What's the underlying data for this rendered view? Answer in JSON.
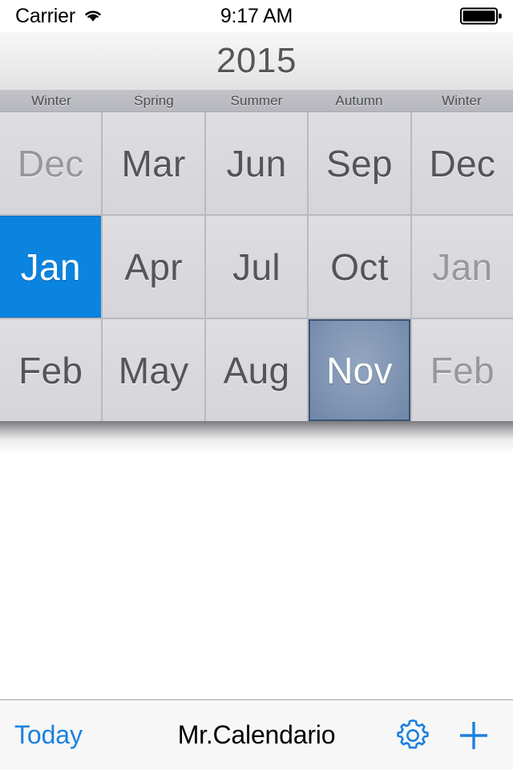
{
  "status_bar": {
    "carrier": "Carrier",
    "wifi_icon": "wifi-icon",
    "time": "9:17 AM",
    "battery_icon": "battery-full-icon"
  },
  "nav_bar": {
    "year": "2015"
  },
  "seasons": [
    {
      "label": "Winter"
    },
    {
      "label": "Spring"
    },
    {
      "label": "Summer"
    },
    {
      "label": "Autumn"
    },
    {
      "label": "Winter"
    }
  ],
  "month_grid": {
    "rows": [
      [
        {
          "label": "Dec",
          "state": "dim"
        },
        {
          "label": "Mar",
          "state": "normal"
        },
        {
          "label": "Jun",
          "state": "normal"
        },
        {
          "label": "Sep",
          "state": "normal"
        },
        {
          "label": "Dec",
          "state": "normal"
        }
      ],
      [
        {
          "label": "Jan",
          "state": "today"
        },
        {
          "label": "Apr",
          "state": "normal"
        },
        {
          "label": "Jul",
          "state": "normal"
        },
        {
          "label": "Oct",
          "state": "normal"
        },
        {
          "label": "Jan",
          "state": "dim"
        }
      ],
      [
        {
          "label": "Feb",
          "state": "normal"
        },
        {
          "label": "May",
          "state": "normal"
        },
        {
          "label": "Aug",
          "state": "normal"
        },
        {
          "label": "Nov",
          "state": "selected"
        },
        {
          "label": "Feb",
          "state": "dim"
        }
      ]
    ]
  },
  "toolbar": {
    "today_label": "Today",
    "title": "Mr.Calendario",
    "settings_icon": "gear-icon",
    "add_icon": "plus-icon"
  },
  "colors": {
    "accent_blue": "#0b84e0",
    "tint_blue": "#1a80df",
    "selected_slate": "#8095b3",
    "selected_border": "#3c5377",
    "grid_cell": "#d9d9dd",
    "grid_line": "#b9babf",
    "season_header": "#b6b7bd",
    "month_text": "#545558",
    "month_text_dim": "#97989c"
  }
}
